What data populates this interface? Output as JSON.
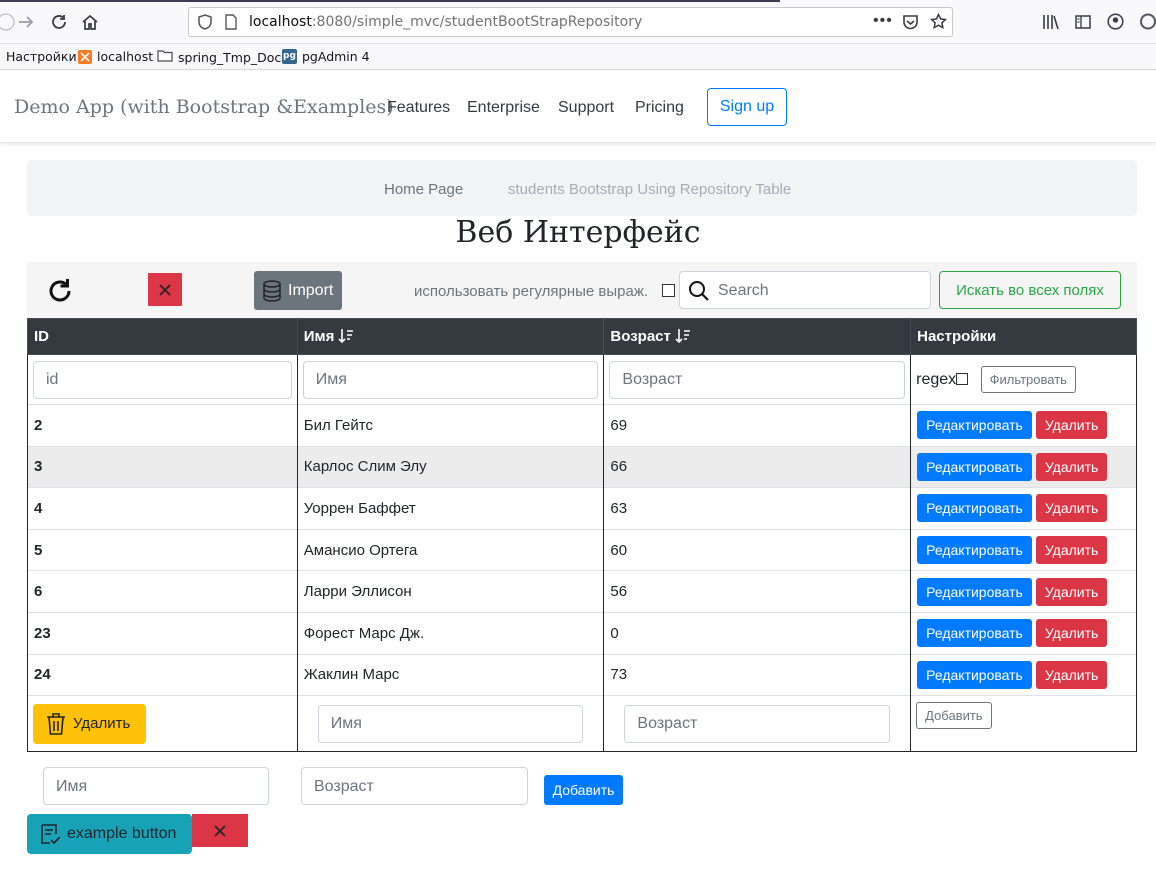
{
  "browser": {
    "url_host": "localhost",
    "url_path": ":8080/simple_mvc/studentBootStrapRepository",
    "bookmarks": [
      "Настройки",
      "localhost",
      "spring_Tmp_Docs",
      "pgAdmin 4"
    ]
  },
  "navbar": {
    "brand": "Demo App (with Bootstrap &Examples)",
    "links": [
      "Features",
      "Enterprise",
      "Support",
      "Pricing"
    ],
    "signup": "Sign up"
  },
  "breadcrumb": {
    "home": "Home Page",
    "current": "students Bootstrap Using Repository Table"
  },
  "title": "Веб Интерфейс",
  "toolbar": {
    "import_label": "Import",
    "regex_label": "использовать регулярные выраж.",
    "search_placeholder": "Search",
    "search_all_label": "Искать во всех полях"
  },
  "table": {
    "headers": {
      "id": "ID",
      "name": "Имя",
      "age": "Возраст",
      "settings": "Настройки"
    },
    "filters": {
      "id": "id",
      "name": "Имя",
      "age": "Возраст",
      "regex": "regex",
      "filter_btn": "Фильтровать"
    },
    "rows": [
      {
        "id": "2",
        "name": "Бил Гейтс",
        "age": "69"
      },
      {
        "id": "3",
        "name": "Карлос Слим Элу",
        "age": "66"
      },
      {
        "id": "4",
        "name": "Уоррен Баффет",
        "age": "63"
      },
      {
        "id": "5",
        "name": "Амансио Ортега",
        "age": "60"
      },
      {
        "id": "6",
        "name": "Ларри Эллисон",
        "age": "56"
      },
      {
        "id": "23",
        "name": "Форест Марс Дж.",
        "age": "0"
      },
      {
        "id": "24",
        "name": "Жаклин Марс",
        "age": "73"
      }
    ],
    "edit_label": "Редактировать",
    "delete_label": "Удалить",
    "footer": {
      "delete_all": "Удалить",
      "name_ph": "Имя",
      "age_ph": "Возраст",
      "add_btn": "Добавить"
    }
  },
  "bottom_form": {
    "name_ph": "Имя",
    "age_ph": "Возраст",
    "add_btn": "Добавить",
    "example_btn": "example button"
  }
}
